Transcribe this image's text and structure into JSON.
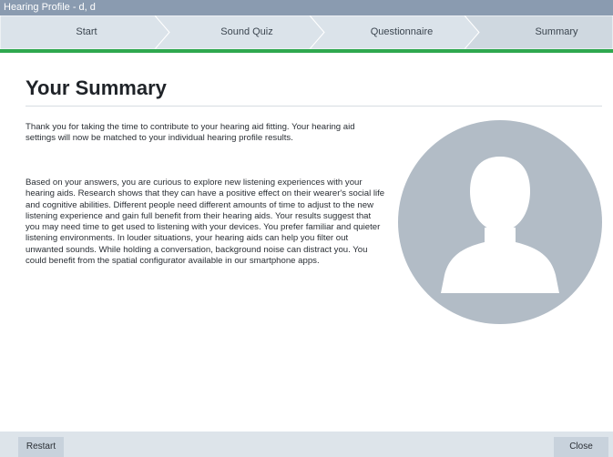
{
  "window": {
    "title": "Hearing Profile - d, d"
  },
  "steps": [
    {
      "label": "Start"
    },
    {
      "label": "Sound Quiz"
    },
    {
      "label": "Questionnaire"
    },
    {
      "label": "Summary"
    }
  ],
  "progress_fraction": 1.0,
  "colors": {
    "titlebar": "#8a9bb0",
    "accent": "#2fa84f",
    "avatar_circle": "#b2bcc6"
  },
  "main": {
    "heading": "Your Summary",
    "paragraphs": [
      "Thank you for taking the time to contribute to your hearing aid fitting. Your hearing aid settings will now be matched to your individual hearing profile results.",
      "Based on your answers, you are curious to explore new listening experiences with your hearing aids. Research shows that they can have a positive effect on their wearer's social life and cognitive abilities. Different people need different amounts of time to adjust to the new listening experience and gain full benefit from their hearing aids. Your results suggest that you may need time to get used to listening with your devices. You prefer familiar and quieter listening environments. In louder situations, your hearing aids can help you filter out unwanted sounds. While holding a conversation, background noise can distract you. You could benefit from the spatial configurator available in our smartphone apps."
    ],
    "avatar_icon": "user-silhouette-icon"
  },
  "footer": {
    "restart_label": "Restart",
    "close_label": "Close"
  }
}
